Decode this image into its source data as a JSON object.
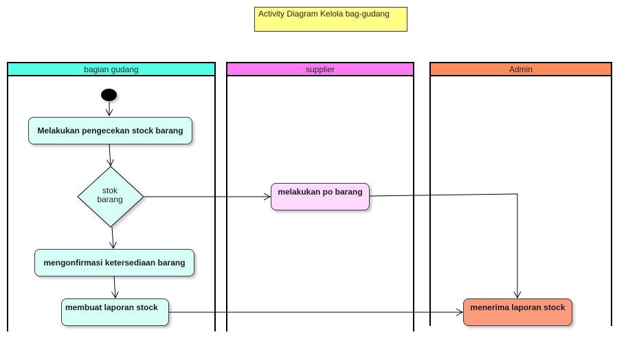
{
  "title": "Activity Diagram Kelola bag-gudang",
  "colors": {
    "lane_gudang": "#57ffe6",
    "lane_supplier": "#f87cf0",
    "lane_admin": "#fa8d5e",
    "action_gudang": "#d7fff6",
    "action_supplier": "#ffd9ff",
    "action_admin": "#fc9a7c",
    "decision": "#d7fff6",
    "note": "#ffff88"
  },
  "lanes": [
    {
      "id": "gudang",
      "label": "bagian gudang"
    },
    {
      "id": "supplier",
      "label": "supplier"
    },
    {
      "id": "admin",
      "label": "Admin"
    }
  ],
  "nodes": {
    "pengecekan": "Melakukan pengecekan stock barang",
    "decision": {
      "line1": "stok",
      "line2": "barang"
    },
    "konfirmasi": "mengonfirmasi ketersediaan barang",
    "laporan": "membuat laporan stock",
    "po": "melakukan po barang",
    "terima": "menerima laporan stock"
  }
}
